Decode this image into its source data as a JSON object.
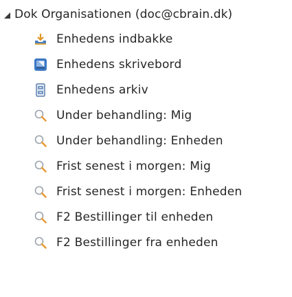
{
  "tree": {
    "root": {
      "label": "Dok Organisationen (doc@cbrain.dk)",
      "expanded": true
    },
    "items": [
      {
        "label": "Enhedens indbakke",
        "icon": "inbox-download-icon"
      },
      {
        "label": "Enhedens skrivebord",
        "icon": "desk-icon"
      },
      {
        "label": "Enhedens arkiv",
        "icon": "archive-cabinet-icon"
      },
      {
        "label": "Under behandling: Mig",
        "icon": "search-icon"
      },
      {
        "label": "Under behandling: Enheden",
        "icon": "search-icon"
      },
      {
        "label": "Frist senest i morgen: Mig",
        "icon": "search-icon"
      },
      {
        "label": "Frist senest i morgen: Enheden",
        "icon": "search-icon"
      },
      {
        "label": "F2 Bestillinger til enheden",
        "icon": "search-icon"
      },
      {
        "label": "F2 Bestillinger fra enheden",
        "icon": "search-icon"
      }
    ]
  },
  "colors": {
    "text": "#262626",
    "inbox_arrow": "#e0962a",
    "inbox_tray": "#4a7fc1",
    "desk": "#3d79c4",
    "archive": "#5f80ad",
    "search_lens": "#9aa2ab",
    "search_handle": "#e89a34"
  }
}
